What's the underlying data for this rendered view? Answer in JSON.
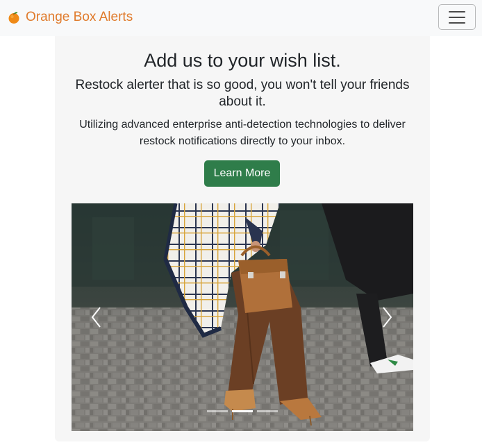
{
  "navbar": {
    "brand_text": "Orange Box Alerts",
    "brand_icon": "orange-fruit-icon",
    "toggler_icon": "hamburger-menu-icon",
    "brand_color": "#e07b2c"
  },
  "hero": {
    "headline": "Add us to your wish list.",
    "lead": "Restock alerter that is so good, you won't tell your friends about it.",
    "description": "Utilizing advanced enterprise anti-detection technologies to deliver restock notifications directly to your inbox.",
    "cta_label": "Learn More",
    "cta_color": "#2f7d4a"
  },
  "carousel": {
    "image": "street-style-tan-handbag-photo",
    "prev_icon": "chevron-left-icon",
    "next_icon": "chevron-right-icon",
    "slide_count": 3,
    "active_index": 1
  }
}
